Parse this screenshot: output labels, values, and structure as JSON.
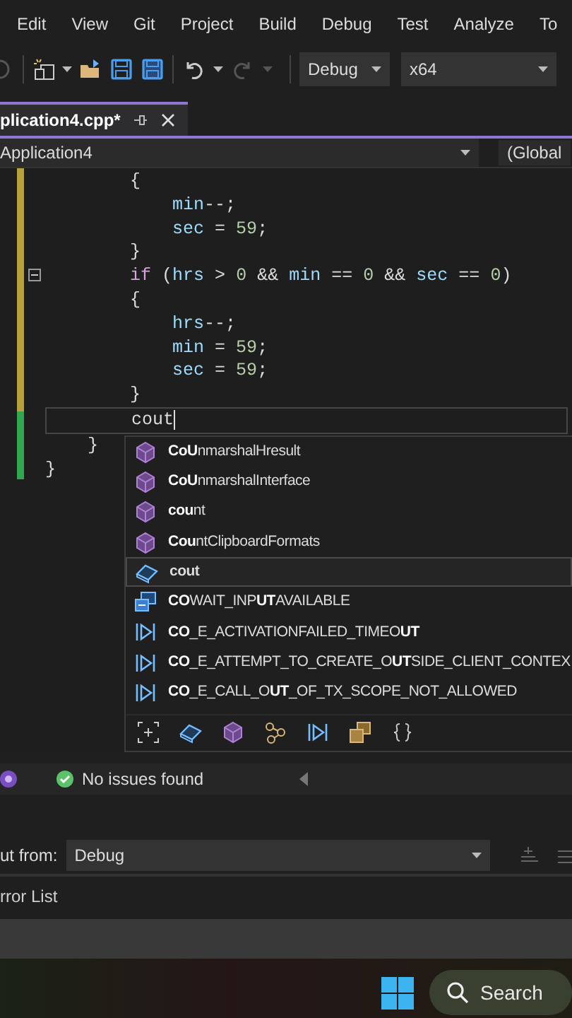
{
  "menu": [
    {
      "label": "Edit"
    },
    {
      "label": "View"
    },
    {
      "label": "Git"
    },
    {
      "label": "Project"
    },
    {
      "label": "Build"
    },
    {
      "label": "Debug"
    },
    {
      "label": "Test"
    },
    {
      "label": "Analyze"
    },
    {
      "label": "To"
    }
  ],
  "toolbar": {
    "redo": {
      "disabled": true
    },
    "configuration": "Debug",
    "platform": "x64"
  },
  "editor_tab": {
    "title": "plication4.cpp*",
    "selected": true
  },
  "nav": {
    "project": "Application4",
    "scope": "(Global"
  },
  "code_lines": [
    {
      "current": false,
      "tokens": [
        {
          "kind": "plain",
          "text": "        {"
        }
      ]
    },
    {
      "current": false,
      "tokens": [
        {
          "kind": "variable",
          "text": "            min"
        },
        {
          "kind": "plain",
          "text": "--;"
        }
      ]
    },
    {
      "current": false,
      "tokens": [
        {
          "kind": "variable",
          "text": "            sec"
        },
        {
          "kind": "plain",
          "text": " = "
        },
        {
          "kind": "number",
          "text": "59"
        },
        {
          "kind": "plain",
          "text": ";"
        }
      ]
    },
    {
      "current": false,
      "tokens": [
        {
          "kind": "plain",
          "text": "        }"
        }
      ]
    },
    {
      "current": false,
      "tokens": [
        {
          "kind": "keyword",
          "text": "        if"
        },
        {
          "kind": "plain",
          "text": " ("
        },
        {
          "kind": "variable",
          "text": "hrs"
        },
        {
          "kind": "plain",
          "text": " > "
        },
        {
          "kind": "number",
          "text": "0"
        },
        {
          "kind": "plain",
          "text": " && "
        },
        {
          "kind": "variable",
          "text": "min"
        },
        {
          "kind": "plain",
          "text": " == "
        },
        {
          "kind": "number",
          "text": "0"
        },
        {
          "kind": "plain",
          "text": " && "
        },
        {
          "kind": "variable",
          "text": "sec"
        },
        {
          "kind": "plain",
          "text": " == "
        },
        {
          "kind": "number",
          "text": "0"
        },
        {
          "kind": "plain",
          "text": ")"
        }
      ]
    },
    {
      "current": false,
      "tokens": [
        {
          "kind": "plain",
          "text": "        {"
        }
      ]
    },
    {
      "current": false,
      "tokens": [
        {
          "kind": "variable",
          "text": "            hrs"
        },
        {
          "kind": "plain",
          "text": "--;"
        }
      ]
    },
    {
      "current": false,
      "tokens": [
        {
          "kind": "variable",
          "text": "            min"
        },
        {
          "kind": "plain",
          "text": " = "
        },
        {
          "kind": "number",
          "text": "59"
        },
        {
          "kind": "plain",
          "text": ";"
        }
      ]
    },
    {
      "current": false,
      "tokens": [
        {
          "kind": "variable",
          "text": "            sec"
        },
        {
          "kind": "plain",
          "text": " = "
        },
        {
          "kind": "number",
          "text": "59"
        },
        {
          "kind": "plain",
          "text": ";"
        }
      ]
    },
    {
      "current": false,
      "tokens": [
        {
          "kind": "plain",
          "text": "        }"
        }
      ]
    },
    {
      "current": true,
      "tokens": [
        {
          "kind": "plain",
          "text": "        cout"
        }
      ]
    },
    {
      "current": false,
      "tokens": [
        {
          "kind": "plain",
          "text": "    }"
        }
      ]
    },
    {
      "current": false,
      "tokens": [
        {
          "kind": "plain",
          "text": "}"
        }
      ]
    }
  ],
  "completion": {
    "items": [
      {
        "kind": "function",
        "selected": false,
        "label": "**CoU**nmarshalHresult"
      },
      {
        "kind": "function",
        "selected": false,
        "label": "**CoU**nmarshalInterface"
      },
      {
        "kind": "function",
        "selected": false,
        "label": "**cou**nt"
      },
      {
        "kind": "function",
        "selected": false,
        "label": "**Cou**ntClipboardFormats"
      },
      {
        "kind": "variable",
        "selected": true,
        "label": "cout"
      },
      {
        "kind": "macro",
        "selected": false,
        "label": "**CO**WAIT_INP**UT**AVAILABLE"
      },
      {
        "kind": "constant",
        "selected": false,
        "label": "**CO**_E_ACTIVATIONFAILED_TIMEO**UT**"
      },
      {
        "kind": "constant",
        "selected": false,
        "label": "**CO**_E_ATTEMPT_TO_CREATE_O**UT**SIDE_CLIENT_CONTEX"
      },
      {
        "kind": "constant",
        "selected": false,
        "label": "**CO**_E_CALL_O**UT**_OF_TX_SCOPE_NOT_ALLOWED"
      }
    ]
  },
  "status": {
    "message": "No issues found"
  },
  "output": {
    "label": "ut from:",
    "source": "Debug"
  },
  "bottom_tab": {
    "label": "rror List"
  },
  "taskbar": {
    "search": "Search"
  }
}
